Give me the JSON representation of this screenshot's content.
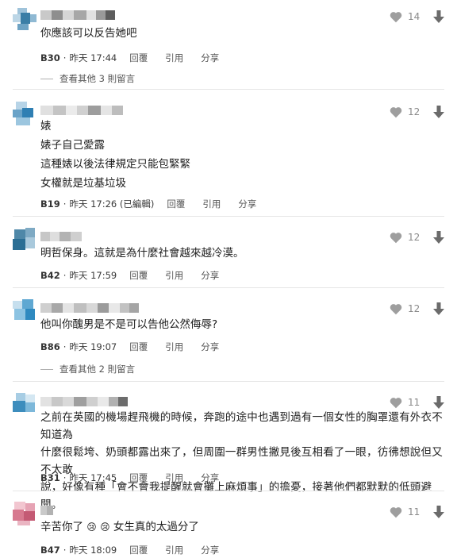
{
  "actions": {
    "reply": "回覆",
    "quote": "引用",
    "share": "分享"
  },
  "comments": [
    {
      "likes": "14",
      "lines": [
        "你應該可以反告她吧"
      ],
      "floor": "B30",
      "time": "昨天 17:44",
      "more_replies": "查看其他 3 則留言"
    },
    {
      "likes": "12",
      "lines": [
        "婊",
        "婊子自己愛露",
        "這種婊以後法律規定只能包緊緊",
        "女權就是垃基垃圾"
      ],
      "floor": "B19",
      "time": "昨天 17:26 (已編輯)"
    },
    {
      "likes": "12",
      "lines": [
        "明哲保身。這就是為什麼社會越來越冷漠。"
      ],
      "floor": "B42",
      "time": "昨天 17:59"
    },
    {
      "likes": "12",
      "lines": [
        "他叫你醜男是不是可以告他公然侮辱?"
      ],
      "floor": "B86",
      "time": "昨天 19:07",
      "more_replies": "查看其他 2 則留言"
    },
    {
      "likes": "11",
      "lines": [
        "之前在英國的機場趕飛機的時候，奔跑的途中也遇到過有一個女性的胸罩還有外衣不知道為",
        "什麼很鬆垮、奶頭都露出來了，但周圍一群男性撇見後互相看了一眼，彷彿想說但又不太敢",
        "說，好像有種「會不會我提醒就會攤上麻煩事」的擔憂，接著他們都默默的低頭避開。"
      ],
      "floor": "B31",
      "time": "昨天 17:45"
    },
    {
      "likes": "11",
      "line_parts": [
        "辛苦你了",
        "😢",
        "😢",
        "女生真的太過分了"
      ],
      "floor": "B47",
      "time": "昨天 18:09"
    }
  ],
  "colors": {
    "heart": "#9e9e9e",
    "down_arrow": "#6b6b6b",
    "likes_text": "#8a8a8a",
    "divider": "#e6e6e6"
  }
}
